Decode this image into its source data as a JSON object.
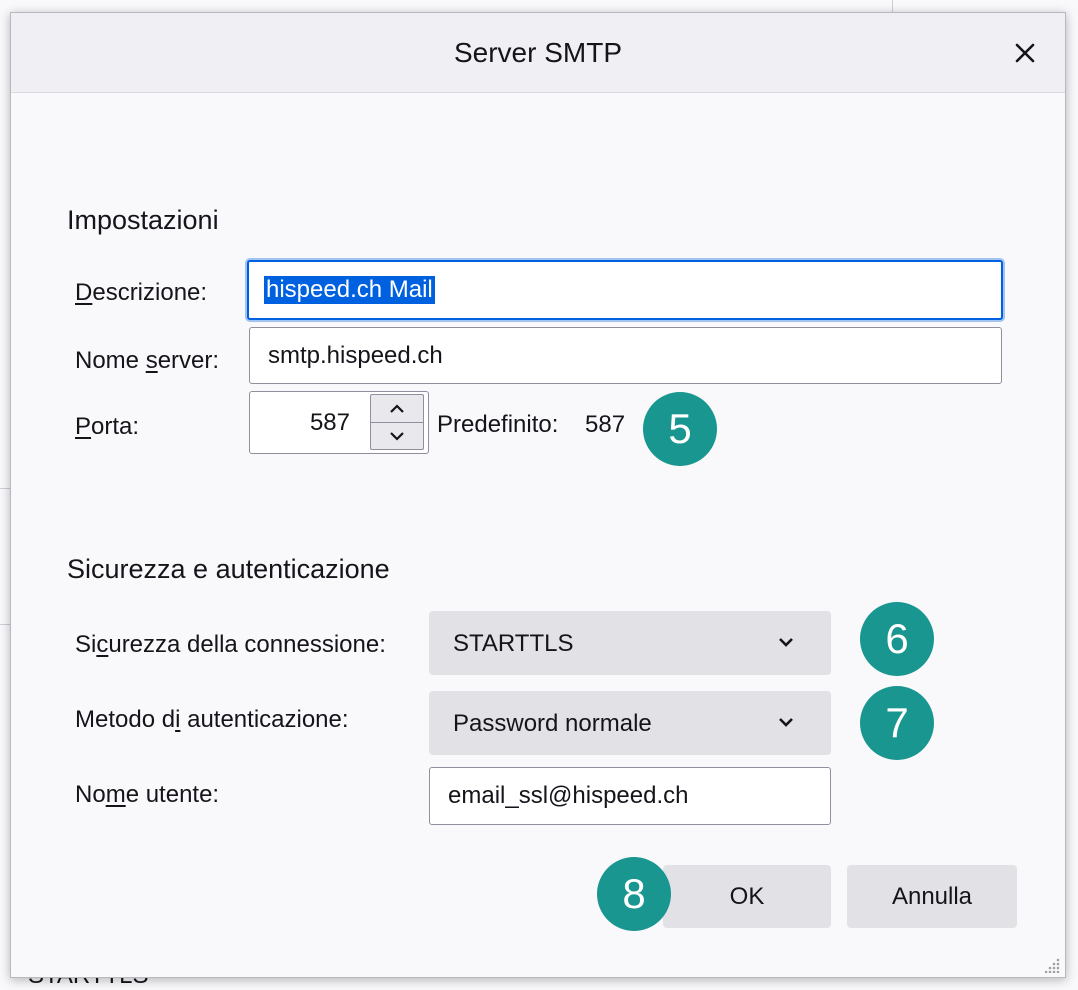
{
  "dialog": {
    "title": "Server SMTP"
  },
  "settings": {
    "heading": "Impostazioni",
    "description_label_u": "D",
    "description_label_rest": "escrizione:",
    "description_value": "hispeed.ch Mail",
    "server_label_pre": "Nome ",
    "server_label_u": "s",
    "server_label_rest": "erver:",
    "server_value": "smtp.hispeed.ch",
    "port_label_u": "P",
    "port_label_rest": "orta:",
    "port_value": "587",
    "default_label": "Predefinito:",
    "default_value": "587"
  },
  "security": {
    "heading": "Sicurezza e autenticazione",
    "connection_label_pre": "Si",
    "connection_label_u": "c",
    "connection_label_rest": "urezza della connessione:",
    "connection_value": "STARTTLS",
    "auth_label_pre": "Metodo d",
    "auth_label_u": "i",
    "auth_label_rest": " autenticazione:",
    "auth_value": "Password normale",
    "user_label_pre": "No",
    "user_label_u": "m",
    "user_label_rest": "e utente:",
    "user_value": "email_ssl@hispeed.ch"
  },
  "buttons": {
    "ok": "OK",
    "cancel": "Annulla"
  },
  "badges": {
    "port": "5",
    "connection": "6",
    "auth": "7",
    "ok": "8"
  },
  "background": {
    "bottom_text": "STARTTLS"
  },
  "colors": {
    "badge": "#1a9690",
    "focus": "#0061e0",
    "dialog_bg": "#f9f9fb"
  }
}
